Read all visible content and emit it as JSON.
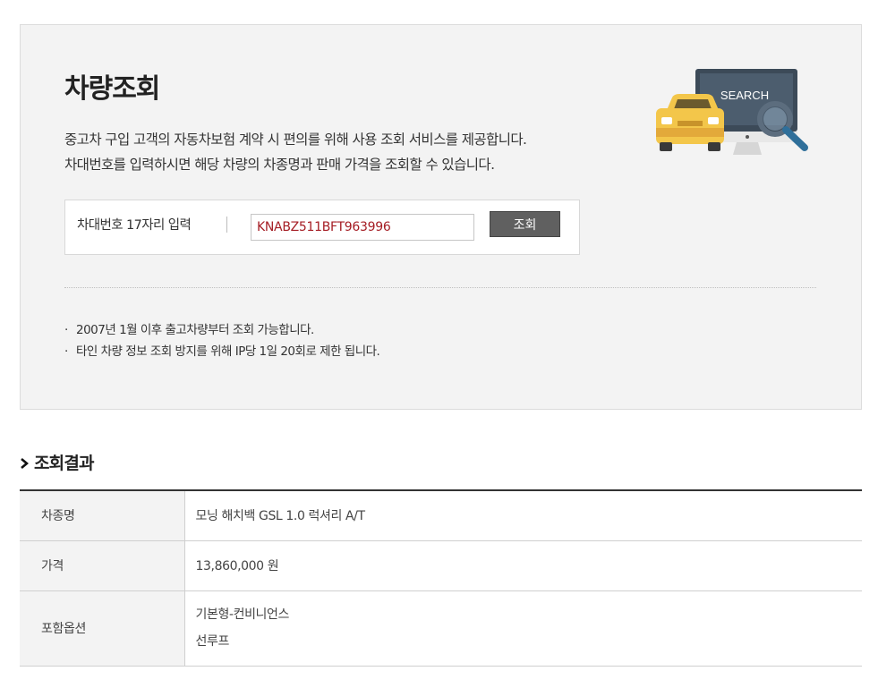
{
  "lookup": {
    "title": "차량조회",
    "description_1": "중고차 구입 고객의 자동차보험 계약 시 편의를 위해 사용 조회 서비스를 제공합니다.",
    "description_2": "차대번호를 입력하시면 해당 차량의 차종명과 판매 가격을 조회할 수 있습니다.",
    "illustration_text": "SEARCH",
    "form": {
      "label": "차대번호 17자리 입력",
      "vin_value": "KNABZ511BFT963996",
      "button_label": "조회"
    },
    "notes": [
      "2007년 1월 이후 출고차량부터 조회 가능합니다.",
      "타인 차량 정보 조회 방지를 위해 IP당 1일 20회로 제한 됩니다."
    ]
  },
  "result": {
    "heading": "조회결과",
    "rows": [
      {
        "label": "차종명",
        "value": "모닝 해치백 GSL 1.0 럭셔리 A/T"
      },
      {
        "label": "가격",
        "value": "13,860,000 원"
      },
      {
        "label": "포함옵션",
        "values": [
          "기본형-컨비니언스",
          "선루프"
        ]
      }
    ]
  },
  "colors": {
    "accent_input_text": "#a51d24",
    "button_bg": "#606060",
    "panel_bg": "#f3f3f3",
    "car_yellow": "#f3c64a",
    "monitor_dark": "#3c4a58"
  }
}
